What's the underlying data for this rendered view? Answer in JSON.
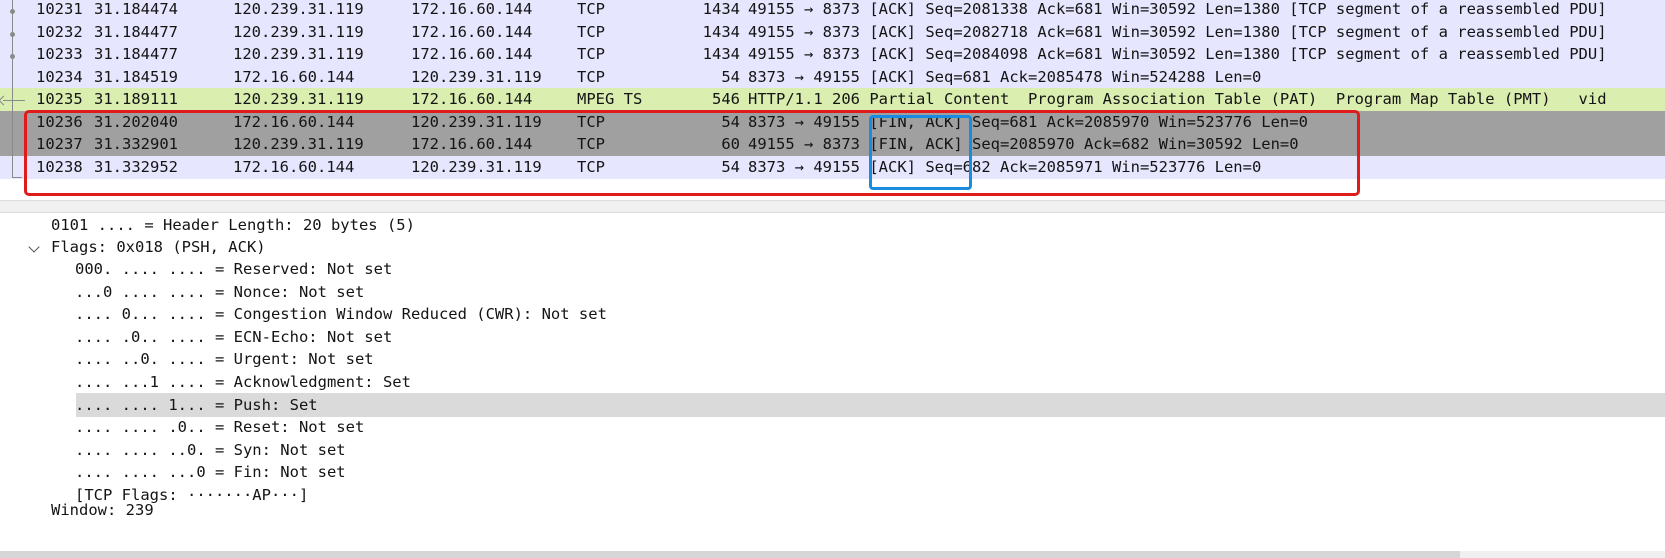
{
  "packet_list": {
    "rows": [
      {
        "no": "10231",
        "time": "31.184474",
        "src": "120.239.31.119",
        "dst": "172.16.60.144",
        "proto": "TCP",
        "len": "1434",
        "info_pre": "49155 → 8373 ",
        "flags": "[ACK]",
        "info_post": " Seq=2081338 Ack=681 Win=30592 Len=1380 [TCP segment of a reassembled PDU]",
        "bg": "#e7e6ff"
      },
      {
        "no": "10232",
        "time": "31.184477",
        "src": "120.239.31.119",
        "dst": "172.16.60.144",
        "proto": "TCP",
        "len": "1434",
        "info_pre": "49155 → 8373 ",
        "flags": "[ACK]",
        "info_post": " Seq=2082718 Ack=681 Win=30592 Len=1380 [TCP segment of a reassembled PDU]",
        "bg": "#e7e6ff"
      },
      {
        "no": "10233",
        "time": "31.184477",
        "src": "120.239.31.119",
        "dst": "172.16.60.144",
        "proto": "TCP",
        "len": "1434",
        "info_pre": "49155 → 8373 ",
        "flags": "[ACK]",
        "info_post": " Seq=2084098 Ack=681 Win=30592 Len=1380 [TCP segment of a reassembled PDU]",
        "bg": "#e7e6ff"
      },
      {
        "no": "10234",
        "time": "31.184519",
        "src": "172.16.60.144",
        "dst": "120.239.31.119",
        "proto": "TCP",
        "len": "54",
        "info_pre": "8373 → 49155 ",
        "flags": "[ACK]",
        "info_post": " Seq=681 Ack=2085478 Win=524288 Len=0",
        "bg": "#e7e6ff"
      },
      {
        "no": "10235",
        "time": "31.189111",
        "src": "120.239.31.119",
        "dst": "172.16.60.144",
        "proto": "MPEG TS",
        "len": "546",
        "info_pre": "HTTP/1.1 206 Partial Content  Program Association Table (PAT)  Program Map Table (PMT)   vid",
        "flags": "",
        "info_post": "",
        "bg": "#daeeb0"
      },
      {
        "no": "10236",
        "time": "31.202040",
        "src": "172.16.60.144",
        "dst": "120.239.31.119",
        "proto": "TCP",
        "len": "54",
        "info_pre": "8373 → 49155 ",
        "flags": "[FIN, ACK]",
        "info_post": " Seq=681 Ack=2085970 Win=523776 Len=0",
        "bg": "#a0a0a0"
      },
      {
        "no": "10237",
        "time": "31.332901",
        "src": "120.239.31.119",
        "dst": "172.16.60.144",
        "proto": "TCP",
        "len": "60",
        "info_pre": "49155 → 8373 ",
        "flags": "[FIN, ACK]",
        "info_post": " Seq=2085970 Ack=682 Win=30592 Len=0",
        "bg": "#a0a0a0"
      },
      {
        "no": "10238",
        "time": "31.332952",
        "src": "172.16.60.144",
        "dst": "120.239.31.119",
        "proto": "TCP",
        "len": "54",
        "info_pre": "8373 → 49155 ",
        "flags": "[ACK]",
        "info_post": " Seq=682 Ack=2085971 Win=523776 Len=0",
        "bg": "#e7e6ff"
      }
    ]
  },
  "details": {
    "header_length": "0101 .... = Header Length: 20 bytes (5)",
    "flags": "Flags: 0x018 (PSH, ACK)",
    "flag_lines": [
      "000. .... .... = Reserved: Not set",
      "...0 .... .... = Nonce: Not set",
      ".... 0... .... = Congestion Window Reduced (CWR): Not set",
      ".... .0.. .... = ECN-Echo: Not set",
      ".... ..0. .... = Urgent: Not set",
      ".... ...1 .... = Acknowledgment: Set",
      ".... .... 1... = Push: Set",
      ".... .... .0.. = Reset: Not set",
      ".... .... ..0. = Syn: Not set",
      ".... .... ...0 = Fin: Not set",
      "[TCP Flags: ·······AP···]"
    ],
    "window": "Window: 239"
  }
}
